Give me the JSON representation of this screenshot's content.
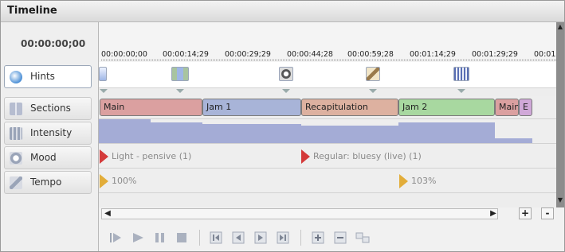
{
  "window": {
    "title": "Timeline"
  },
  "time": {
    "current": "00:00:00;00"
  },
  "ruler": {
    "labels": [
      "00:00:00;00",
      "00:00:14;29",
      "00:00:29;29",
      "00:00:44;28",
      "00:00:59;28",
      "00:01:14;29",
      "00:01:29;29",
      "00:01"
    ]
  },
  "tracks": [
    {
      "label": "Hints",
      "icon": "hints-icon",
      "selected": true
    },
    {
      "label": "Sections",
      "icon": "sections-icon"
    },
    {
      "label": "Intensity",
      "icon": "intensity-icon"
    },
    {
      "label": "Mood",
      "icon": "mood-icon"
    },
    {
      "label": "Tempo",
      "icon": "tempo-icon"
    }
  ],
  "hints": {
    "icons": [
      "hint-marker-icon",
      "hint-band-icon",
      "hint-yin-yang-icon",
      "hint-metronome-icon",
      "hint-chart-icon"
    ]
  },
  "sections": [
    {
      "label": "Main",
      "color": "#dba0a0"
    },
    {
      "label": "Jam 1",
      "color": "#a8b4d8"
    },
    {
      "label": "Recapitulation",
      "color": "#ddb1a0"
    },
    {
      "label": "Jam 2",
      "color": "#a8d8a0"
    },
    {
      "label": "Main",
      "color": "#dba0a0"
    },
    {
      "label": "E",
      "color": "#d0a8d8"
    }
  ],
  "mood": [
    {
      "text": "Light - pensive (1)"
    },
    {
      "text": "Regular: bluesy (live) (1)"
    }
  ],
  "tempo": [
    {
      "text": "100%"
    },
    {
      "text": "103%"
    }
  ],
  "intensity": {
    "color": "#a4acd6"
  },
  "scrollbar": {
    "plus": "+",
    "minus": "-"
  },
  "transport": {
    "buttons": [
      "play-from-start-icon",
      "play-icon",
      "pause-icon",
      "stop-icon",
      "go-to-start-icon",
      "step-back-icon",
      "step-forward-icon",
      "go-to-end-icon",
      "add-icon",
      "remove-icon",
      "split-icon"
    ]
  }
}
